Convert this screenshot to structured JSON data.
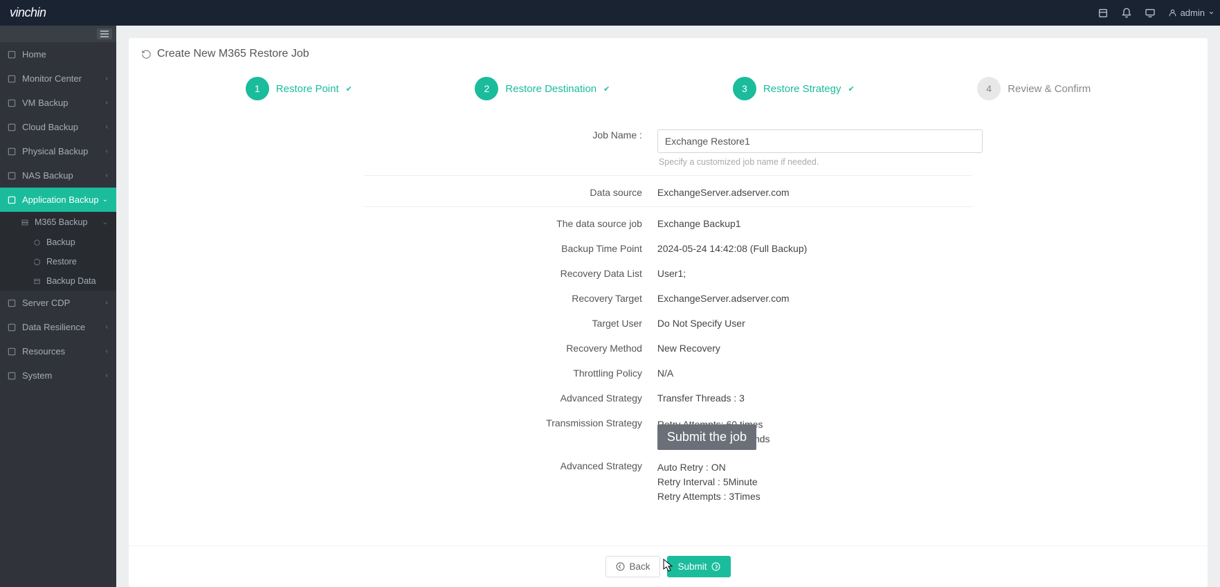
{
  "brand": "vinchin",
  "user": "admin",
  "sidebar": {
    "items": [
      {
        "label": "Home",
        "expandable": false
      },
      {
        "label": "Monitor Center",
        "expandable": true
      },
      {
        "label": "VM Backup",
        "expandable": true
      },
      {
        "label": "Cloud Backup",
        "expandable": true
      },
      {
        "label": "Physical Backup",
        "expandable": true
      },
      {
        "label": "NAS Backup",
        "expandable": true
      },
      {
        "label": "Application Backup",
        "expandable": true,
        "active": true
      },
      {
        "label": "Server CDP",
        "expandable": true
      },
      {
        "label": "Data Resilience",
        "expandable": true
      },
      {
        "label": "Resources",
        "expandable": true
      },
      {
        "label": "System",
        "expandable": true
      }
    ],
    "app_children": [
      {
        "label": "M365 Backup",
        "expandable": true
      }
    ],
    "m365_children": [
      {
        "label": "Backup"
      },
      {
        "label": "Restore"
      },
      {
        "label": "Backup Data"
      }
    ]
  },
  "page": {
    "title": "Create New M365 Restore Job"
  },
  "stepper": [
    {
      "num": "1",
      "label": "Restore Point",
      "done": true
    },
    {
      "num": "2",
      "label": "Restore Destination",
      "done": true
    },
    {
      "num": "3",
      "label": "Restore Strategy",
      "done": true
    },
    {
      "num": "4",
      "label": "Review & Confirm",
      "done": false
    }
  ],
  "form": {
    "job_name_label": "Job Name :",
    "job_name_value": "Exchange Restore1",
    "job_name_hint": "Specify a customized job name if needed.",
    "rows": [
      {
        "label": "Data source",
        "value": "ExchangeServer.adserver.com"
      },
      {
        "label": "The data source job",
        "value": "Exchange Backup1"
      },
      {
        "label": "Backup Time Point",
        "value": "2024-05-24 14:42:08 (Full Backup)"
      },
      {
        "label": "Recovery Data List",
        "value": "User1;"
      },
      {
        "label": "Recovery Target",
        "value": "ExchangeServer.adserver.com"
      },
      {
        "label": "Target User",
        "value": "Do Not Specify User"
      },
      {
        "label": "Recovery Method",
        "value": "New Recovery"
      },
      {
        "label": "Throttling Policy",
        "value": "N/A"
      },
      {
        "label": "Advanced Strategy",
        "value": "Transfer Threads : 3"
      }
    ],
    "transmission_label": "Transmission Strategy",
    "transmission_lines": [
      "Retry Attempts: 60 times",
      "Retry Interval: 30 seconds"
    ],
    "adv2_label": "Advanced Strategy",
    "adv2_lines": [
      "Auto Retry :  ON",
      "Retry Interval :  5Minute",
      "Retry Attempts :  3Times"
    ]
  },
  "buttons": {
    "back": "Back",
    "submit": "Submit"
  },
  "tooltip": "Submit the job"
}
